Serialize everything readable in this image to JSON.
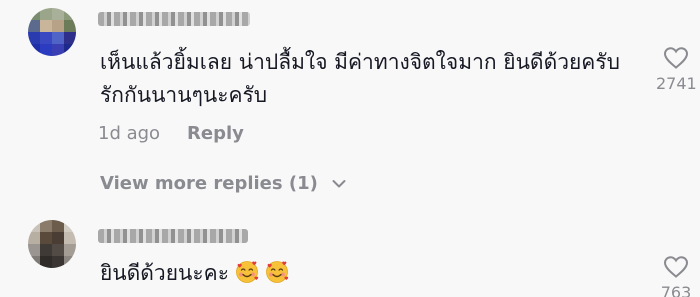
{
  "comments": [
    {
      "text_lines": [
        "เห็นแล้วยิ้มเลย น่าปลื้มใจ มีค่าทางจิตใจมาก ยินดีด้วยครับ",
        "รักกันนานๆนะครับ"
      ],
      "time": "1d ago",
      "reply_label": "Reply",
      "likes": "2741",
      "avatar_icon": "avatar-pixelated"
    },
    {
      "text": "ยินดีด้วยนะคะ",
      "emojis": [
        "smiling-face-with-hearts",
        "smiling-face-with-hearts"
      ],
      "likes": "763",
      "avatar_icon": "avatar-pixelated"
    }
  ],
  "view_more_replies": "View more replies (1)",
  "icons": {
    "like": "heart-outline-icon",
    "expand": "chevron-down-icon"
  },
  "colors": {
    "background": "#f8f8f8",
    "text": "#161823",
    "secondary": "#8a8b91"
  }
}
